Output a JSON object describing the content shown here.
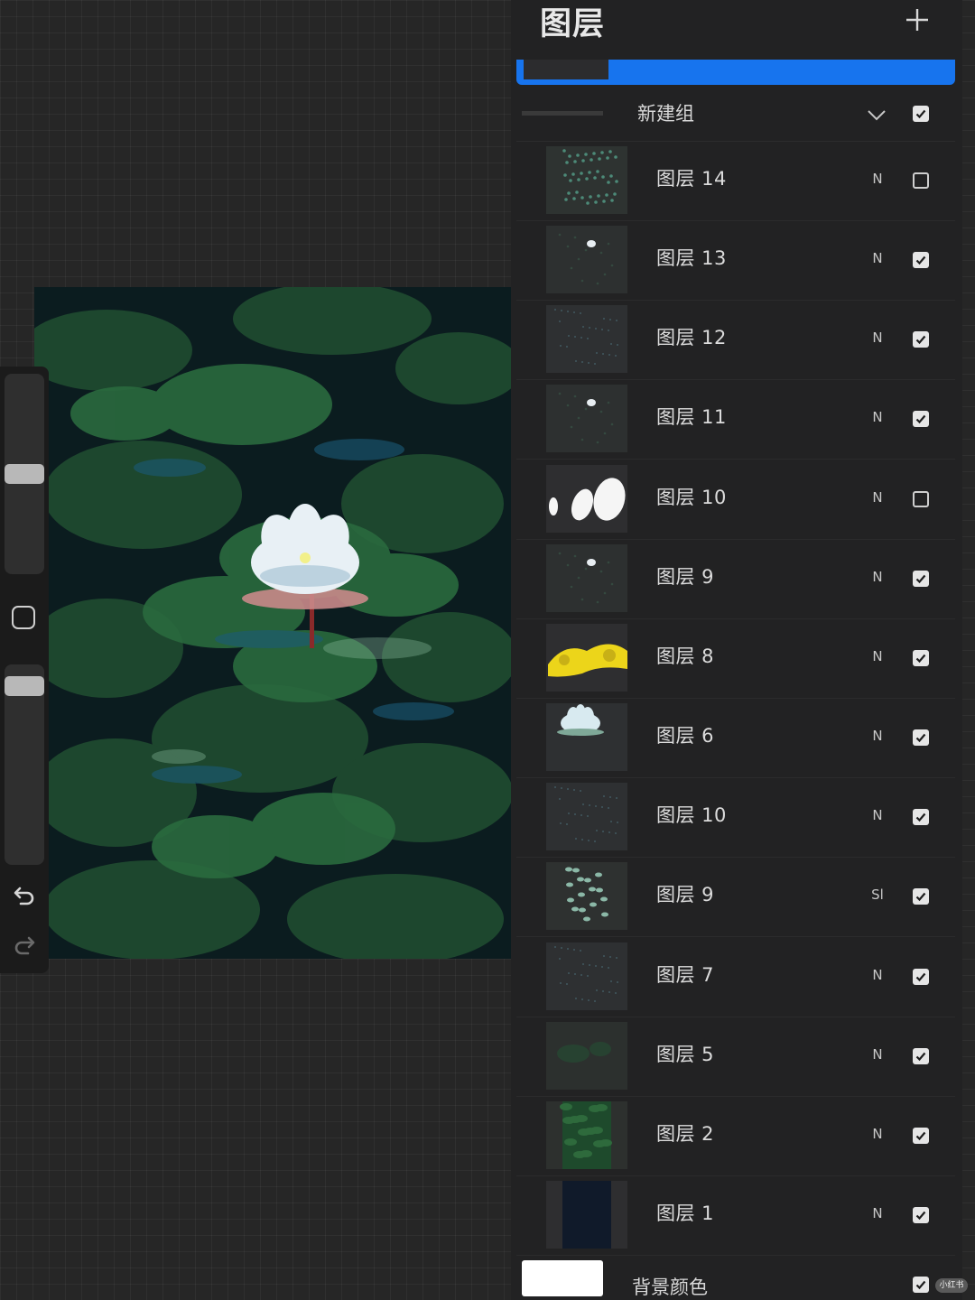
{
  "panel": {
    "title": "图层",
    "add_icon": "plus-icon"
  },
  "group": {
    "name": "新建组",
    "expanded": true,
    "visible": true,
    "chevron_icon": "chevron-down-icon"
  },
  "layers": [
    {
      "name": "图层 14",
      "mode": "N",
      "visible": false,
      "thumb": "scatter-teal"
    },
    {
      "name": "图层 13",
      "mode": "N",
      "visible": true,
      "thumb": "small-flower"
    },
    {
      "name": "图层 12",
      "mode": "N",
      "visible": true,
      "thumb": "faint-dots"
    },
    {
      "name": "图层 11",
      "mode": "N",
      "visible": true,
      "thumb": "small-flower"
    },
    {
      "name": "图层 10",
      "mode": "N",
      "visible": false,
      "thumb": "white-blobs"
    },
    {
      "name": "图层 9",
      "mode": "N",
      "visible": true,
      "thumb": "small-flower"
    },
    {
      "name": "图层 8",
      "mode": "N",
      "visible": true,
      "thumb": "yellow-brush"
    },
    {
      "name": "图层 6",
      "mode": "N",
      "visible": true,
      "thumb": "lotus"
    },
    {
      "name": "图层 10",
      "mode": "N",
      "visible": true,
      "thumb": "faint-dots"
    },
    {
      "name": "图层 9",
      "mode": "Sl",
      "visible": true,
      "thumb": "green-strokes"
    },
    {
      "name": "图层 7",
      "mode": "N",
      "visible": true,
      "thumb": "faint-dots"
    },
    {
      "name": "图层 5",
      "mode": "N",
      "visible": true,
      "thumb": "dark-green"
    },
    {
      "name": "图层 2",
      "mode": "N",
      "visible": true,
      "thumb": "dense-green"
    },
    {
      "name": "图层 1",
      "mode": "N",
      "visible": true,
      "thumb": "navy-fill"
    }
  ],
  "background_layer": {
    "name": "背景颜色",
    "visible": true,
    "color": "#ffffff"
  },
  "sidebar": {
    "brush_size_level": 0.5,
    "opacity_level": 0.05,
    "undo_icon": "undo-icon",
    "redo_icon": "redo-icon",
    "modify_icon": "square-icon"
  },
  "colors": {
    "accent": "#1774ee",
    "panel_bg": "#222223",
    "canvas_bg": "#0c1d1c"
  },
  "watermark": "小红书"
}
